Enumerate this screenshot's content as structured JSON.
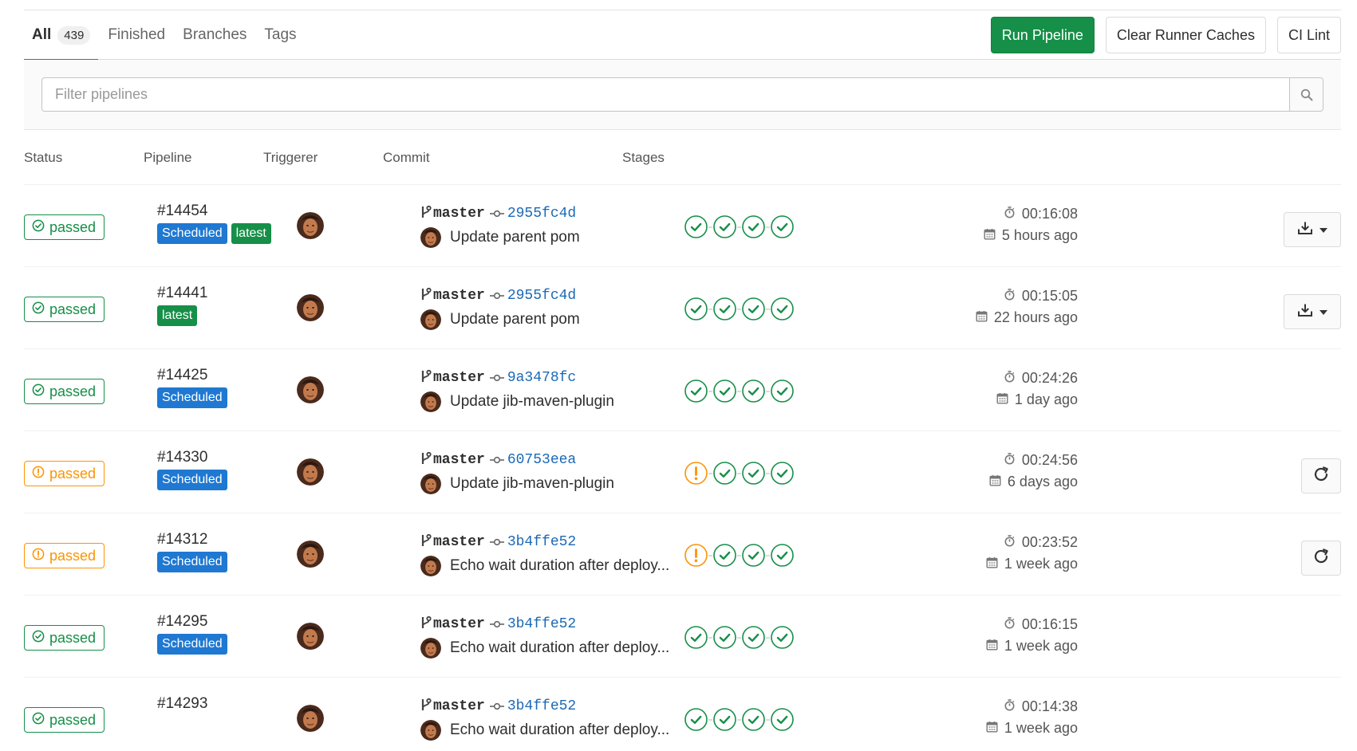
{
  "tabs": [
    {
      "label": "All",
      "count": "439",
      "active": true
    },
    {
      "label": "Finished"
    },
    {
      "label": "Branches"
    },
    {
      "label": "Tags"
    }
  ],
  "toolbar": {
    "run_pipeline": "Run Pipeline",
    "clear_caches": "Clear Runner Caches",
    "ci_lint": "CI Lint"
  },
  "filter": {
    "placeholder": "Filter pipelines",
    "icon": "search-icon"
  },
  "columns": [
    "Status",
    "Pipeline",
    "Triggerer",
    "Commit",
    "Stages"
  ],
  "colors": {
    "success": "#168f48",
    "warning": "#fc9403",
    "link": "#1b69b6",
    "tag_blue": "#1f78d1",
    "tab_active": "#1f78d1"
  },
  "pipelines": [
    {
      "status": "passed",
      "warning": false,
      "id": "#14454",
      "tags": [
        "Scheduled",
        "latest"
      ],
      "branch": "master",
      "sha": "2955fc4d",
      "message": "Update parent pom",
      "stages": [
        "success",
        "success",
        "success",
        "success"
      ],
      "duration": "00:16:08",
      "finished": "5 hours ago",
      "action": "artifacts"
    },
    {
      "status": "passed",
      "warning": false,
      "id": "#14441",
      "tags": [
        "latest"
      ],
      "branch": "master",
      "sha": "2955fc4d",
      "message": "Update parent pom",
      "stages": [
        "success",
        "success",
        "success",
        "success"
      ],
      "duration": "00:15:05",
      "finished": "22 hours ago",
      "action": "artifacts"
    },
    {
      "status": "passed",
      "warning": false,
      "id": "#14425",
      "tags": [
        "Scheduled"
      ],
      "branch": "master",
      "sha": "9a3478fc",
      "message": "Update jib-maven-plugin",
      "stages": [
        "success",
        "success",
        "success",
        "success"
      ],
      "duration": "00:24:26",
      "finished": "1 day ago",
      "action": "none"
    },
    {
      "status": "passed",
      "warning": true,
      "id": "#14330",
      "tags": [
        "Scheduled"
      ],
      "branch": "master",
      "sha": "60753eea",
      "message": "Update jib-maven-plugin",
      "stages": [
        "warning",
        "success",
        "success",
        "success"
      ],
      "duration": "00:24:56",
      "finished": "6 days ago",
      "action": "retry"
    },
    {
      "status": "passed",
      "warning": true,
      "id": "#14312",
      "tags": [
        "Scheduled"
      ],
      "branch": "master",
      "sha": "3b4ffe52",
      "message": "Echo wait duration after deploy...",
      "stages": [
        "warning",
        "success",
        "success",
        "success"
      ],
      "duration": "00:23:52",
      "finished": "1 week ago",
      "action": "retry"
    },
    {
      "status": "passed",
      "warning": false,
      "id": "#14295",
      "tags": [
        "Scheduled"
      ],
      "branch": "master",
      "sha": "3b4ffe52",
      "message": "Echo wait duration after deploy...",
      "stages": [
        "success",
        "success",
        "success",
        "success"
      ],
      "duration": "00:16:15",
      "finished": "1 week ago",
      "action": "none"
    },
    {
      "status": "passed",
      "warning": false,
      "id": "#14293",
      "tags": [],
      "branch": "master",
      "sha": "3b4ffe52",
      "message": "Echo wait duration after deploy...",
      "stages": [
        "success",
        "success",
        "success",
        "success"
      ],
      "duration": "00:14:38",
      "finished": "1 week ago",
      "action": "none"
    }
  ]
}
